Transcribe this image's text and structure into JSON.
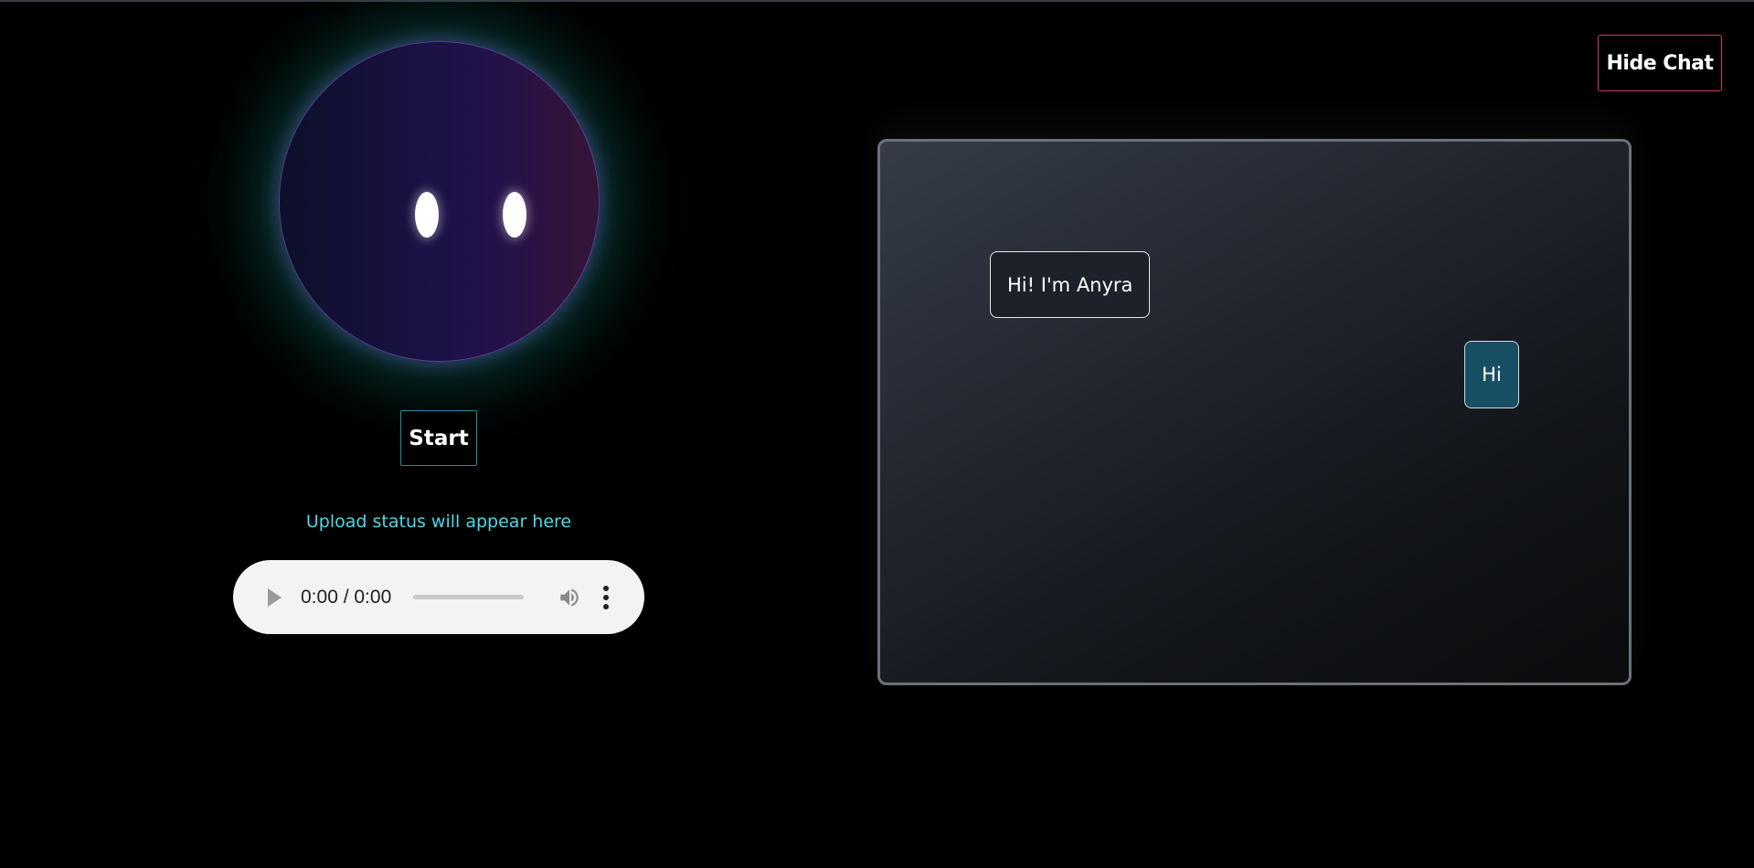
{
  "header": {
    "hide_chat_label": "Hide Chat"
  },
  "avatar": {
    "start_label": "Start",
    "upload_status": "Upload status will appear here"
  },
  "audio_player": {
    "time_display": "0:00 / 0:00",
    "progress": 0
  },
  "chat": {
    "messages": [
      {
        "sender": "bot",
        "text": "Hi! I'm Anyra"
      },
      {
        "sender": "user",
        "text": "Hi"
      }
    ]
  },
  "colors": {
    "background": "#000000",
    "start_border": "#1d8fa3",
    "hide_chat_border": "#d6336c",
    "upload_status_text": "#4fd6e6",
    "user_bubble": "#184e64",
    "panel_border": "#6b7178"
  },
  "icons": {
    "play": "play-icon",
    "volume": "volume-icon",
    "menu": "more-vertical-icon"
  }
}
